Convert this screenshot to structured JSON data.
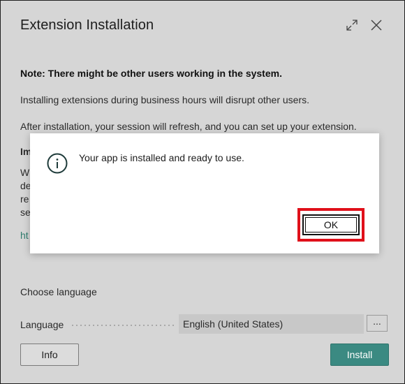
{
  "dialog": {
    "title": "Extension Installation",
    "note": "Note: There might be other users working in the system.",
    "paragraph1": "Installing extensions during business hours will disrupt other users.",
    "paragraph2": "After installation, your session will refresh, and you can set up your extension.",
    "fragments": {
      "im": "Im",
      "w": "W",
      "de": "de",
      "re": "re",
      "se": "se",
      "ht": "ht"
    },
    "choose_language": "Choose language",
    "language_label": "Language",
    "language_value": "English (United States)",
    "more_label": "...",
    "info_button": "Info",
    "install_button": "Install"
  },
  "popup": {
    "message": "Your app is installed and ready to use.",
    "ok_button": "OK"
  },
  "icons": {
    "expand": "expand-icon",
    "close": "close-icon",
    "info": "info-circle-icon"
  },
  "colors": {
    "accent": "#3b8a82",
    "highlight": "#e0101a",
    "link": "#2f7d6d"
  }
}
